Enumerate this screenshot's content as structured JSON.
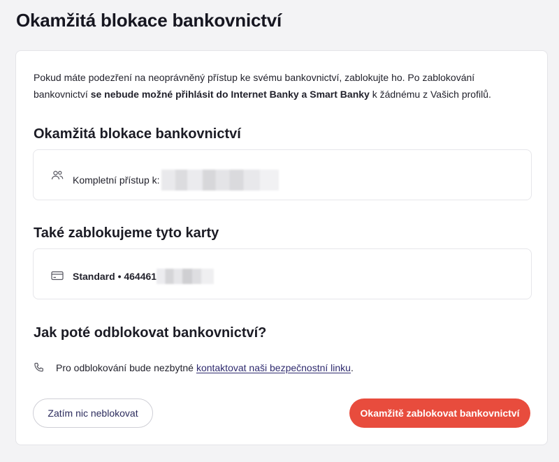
{
  "page": {
    "title": "Okamžitá blokace bankovnictví"
  },
  "intro": {
    "part1": "Pokud máte podezření na neoprávněný přístup ke svému bankovnictví, zablokujte ho. Po zablokování bankovnictví ",
    "bold": "se nebude možné přihlásit do Internet Banky a Smart Banky",
    "part2": " k žádnému z Vašich profilů."
  },
  "access_section": {
    "heading": "Okamžitá blokace bankovnictví",
    "icon": "users-icon",
    "label": "Kompletní přístup k:"
  },
  "cards_section": {
    "heading": "Také zablokujeme tyto karty",
    "icon": "credit-card-icon",
    "card_label": "Standard • 464461"
  },
  "unblock_section": {
    "heading": "Jak poté odblokovat bankovnictví?",
    "icon": "phone-icon",
    "text": "Pro odblokování bude nezbytné",
    "link_text": "kontaktovat naši bezpečnostní linku",
    "suffix": "."
  },
  "buttons": {
    "cancel_label": "Zatím nic neblokovat",
    "block_label": "Okamžitě zablokovat bankovnictví"
  },
  "colors": {
    "primary": "#e84c3d",
    "link": "#2e2a6e"
  }
}
